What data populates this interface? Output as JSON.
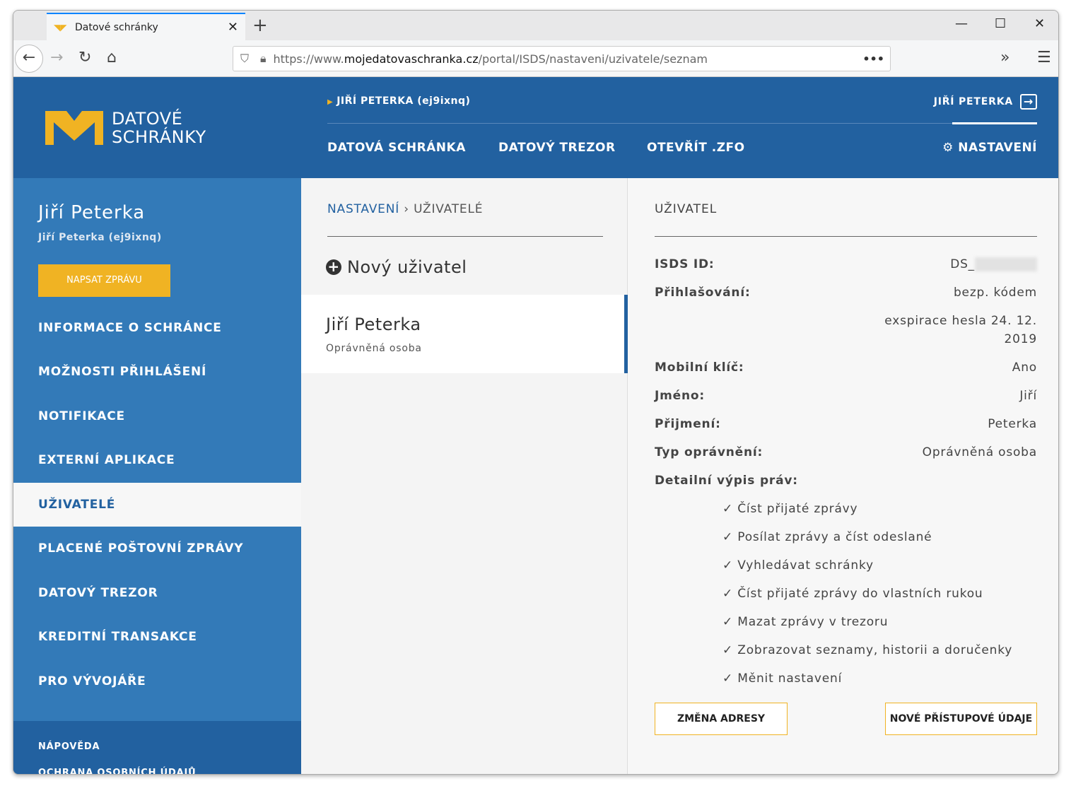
{
  "browser": {
    "tab_title": "Datové schránky",
    "url_prefix": "https://www.",
    "url_domain": "mojedatovaschranka.cz",
    "url_path": "/portal/ISDS/nastaveni/uzivatele/seznam"
  },
  "header": {
    "logo_line1": "DATOVÉ",
    "logo_line2": "SCHRÁNKY",
    "box_user": "JIŘÍ PETERKA (ej9ixnq)",
    "user": "JIŘÍ PETERKA",
    "menu": [
      "DATOVÁ SCHRÁNKA",
      "DATOVÝ TREZOR",
      "OTEVŘÍT .ZFO"
    ],
    "settings": "NASTAVENÍ"
  },
  "sidebar": {
    "name": "Jiří Peterka",
    "sub": "Jiří Peterka (ej9ixnq)",
    "compose": "NAPSAT ZPRÁVU",
    "items": [
      "INFORMACE O SCHRÁNCE",
      "MOŽNOSTI PŘIHLÁŠENÍ",
      "NOTIFIKACE",
      "EXTERNÍ APLIKACE",
      "UŽIVATELÉ",
      "PLACENÉ POŠTOVNÍ ZPRÁVY",
      "DATOVÝ TREZOR",
      "KREDITNÍ TRANSAKCE",
      "PRO VÝVOJÁŘE"
    ],
    "footer": [
      "NÁPOVĚDA",
      "OCHRANA OSOBNÍCH ÚDAJŮ"
    ]
  },
  "list": {
    "breadcrumb_root": "NASTAVENÍ",
    "breadcrumb_current": "UŽIVATELÉ",
    "new_user": "Nový uživatel",
    "user_name": "Jiří Peterka",
    "user_role": "Oprávněná osoba"
  },
  "detail": {
    "title": "UŽIVATEL",
    "isds_label": "ISDS ID:",
    "isds_value": "DS_",
    "login_label": "Přihlašování:",
    "login_value": "bezp. kódem",
    "login_expiry1": "exspirace hesla 24. 12.",
    "login_expiry2": "2019",
    "mobile_label": "Mobilní klíč:",
    "mobile_value": "Ano",
    "first_label": "Jméno:",
    "first_value": "Jiří",
    "last_label": "Přijmení:",
    "last_value": "Peterka",
    "type_label": "Typ oprávnění:",
    "type_value": "Oprávněná osoba",
    "rights_label": "Detailní výpis práv:",
    "rights": [
      "✓ Číst přijaté zprávy",
      "✓ Posílat zprávy a číst odeslané",
      "✓ Vyhledávat schránky",
      "✓ Číst přijaté zprávy do vlastních rukou",
      "✓ Mazat zprávy v trezoru",
      "✓ Zobrazovat seznamy, historii a doručenky",
      "✓ Měnit nastavení"
    ],
    "btn_address": "ZMĚNA ADRESY",
    "btn_credentials": "NOVÉ PŘÍSTUPOVÉ ÚDAJE"
  }
}
